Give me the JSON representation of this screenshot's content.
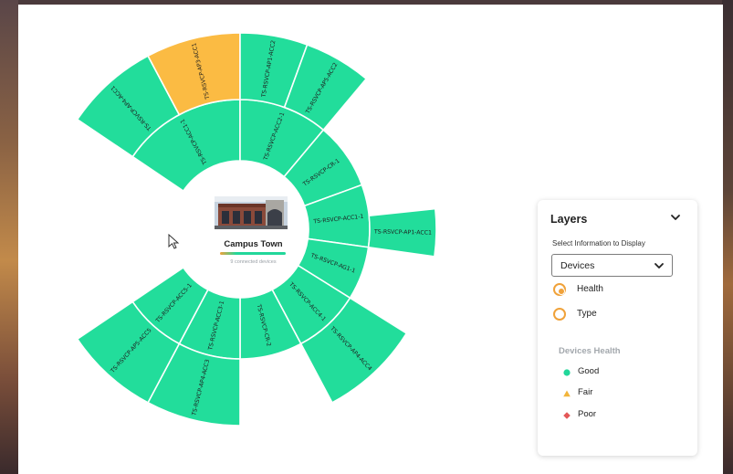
{
  "center": {
    "title": "Campus Town",
    "subtitle": "9 connected devices"
  },
  "colors": {
    "good": "#22dd9b",
    "fair": "#fbbb43",
    "poor": "#ea5a5a",
    "accent": "#f0a23a"
  },
  "rings": {
    "inner": [
      {
        "label": "TS-RSVCP-ACC1-1",
        "status": "good",
        "start": -56,
        "end": 0
      },
      {
        "label": "TS-RSVCP-ACC2-1",
        "status": "good",
        "start": 0,
        "end": 40
      },
      {
        "label": "TS-RSVCP-CR-1",
        "status": "good",
        "start": 40,
        "end": 70
      },
      {
        "label": "TS-RSVCP-ACC1-1",
        "status": "good",
        "start": 70,
        "end": 98
      },
      {
        "label": "TS-RSVCP-AG1-1",
        "status": "good",
        "start": 98,
        "end": 122
      },
      {
        "label": "TS-RSVCP-ACC4-1",
        "status": "good",
        "start": 122,
        "end": 152
      },
      {
        "label": "TS-RSVCP-CR-2",
        "status": "good",
        "start": 152,
        "end": 180
      },
      {
        "label": "TS-RSVCP-ACC3-1",
        "status": "good",
        "start": 180,
        "end": 208
      },
      {
        "label": "TS-RSVCP-ACC5-1",
        "status": "good",
        "start": 208,
        "end": 236
      }
    ],
    "outer": [
      {
        "label": "TS-RSVCP-AP4-ACC1",
        "status": "good",
        "start": -56,
        "end": -28
      },
      {
        "label": "TS-RSVCP-AP3-ACC1",
        "status": "fair",
        "start": -28,
        "end": 0
      },
      {
        "label": "TS-RSVCP-AP1-ACC2",
        "status": "good",
        "start": 0,
        "end": 20
      },
      {
        "label": "TS-RSVCP-AP5-ACC2",
        "status": "good",
        "start": 20,
        "end": 40
      },
      {
        "label": "TS-RSVCP-AP1-ACC1",
        "status": "good",
        "start": 84,
        "end": 98
      },
      {
        "label": "TS-RSVCP-AP4-ACC4",
        "status": "good",
        "start": 122,
        "end": 152
      },
      {
        "label": "TS-RSVCP-AP4-ACC3",
        "status": "good",
        "start": 180,
        "end": 208
      },
      {
        "label": "TS-RSVCP-AP5-ACC5",
        "status": "good",
        "start": 208,
        "end": 236
      }
    ]
  },
  "panel": {
    "title": "Layers",
    "help_text": "Select Information to Display",
    "select_value": "Devices",
    "options": [
      {
        "label": "Health",
        "selected": true
      },
      {
        "label": "Type",
        "selected": false
      }
    ],
    "legend_title": "Devices Health",
    "legend": [
      {
        "label": "Good",
        "shape": "circle",
        "color": "#22d79a"
      },
      {
        "label": "Fair",
        "shape": "triangle",
        "color": "#f2b53a"
      },
      {
        "label": "Poor",
        "shape": "diamond",
        "color": "#e45858"
      }
    ]
  }
}
